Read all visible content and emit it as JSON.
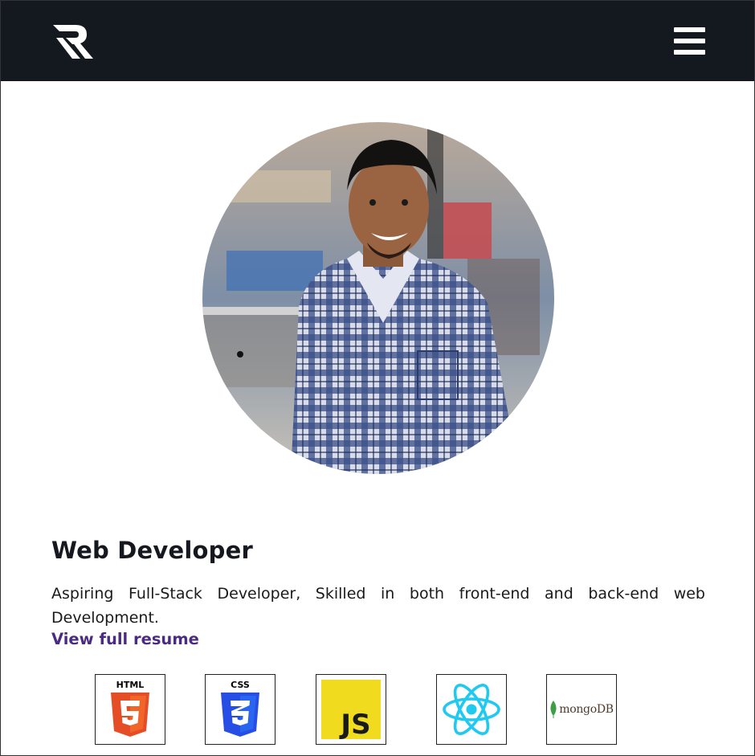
{
  "nav": {
    "logo_icon": "r-logo-icon",
    "menu_icon": "hamburger-menu-icon",
    "background_color": "#141920"
  },
  "hero": {
    "photo_icon": "profile-photo",
    "title": "Web Developer",
    "description": "Aspiring Full-Stack Developer, Skilled in both front-end and back-end web Development.",
    "resume_link": "View full resume",
    "link_color": "#4a2a82"
  },
  "skills": [
    {
      "name": "html5-logo-icon",
      "label": "HTML"
    },
    {
      "name": "css3-logo-icon",
      "label": "CSS"
    },
    {
      "name": "javascript-logo-icon",
      "label": "JS"
    },
    {
      "name": "react-logo-icon"
    },
    {
      "name": "mongodb-logo-icon",
      "label": "mongoDB"
    }
  ]
}
